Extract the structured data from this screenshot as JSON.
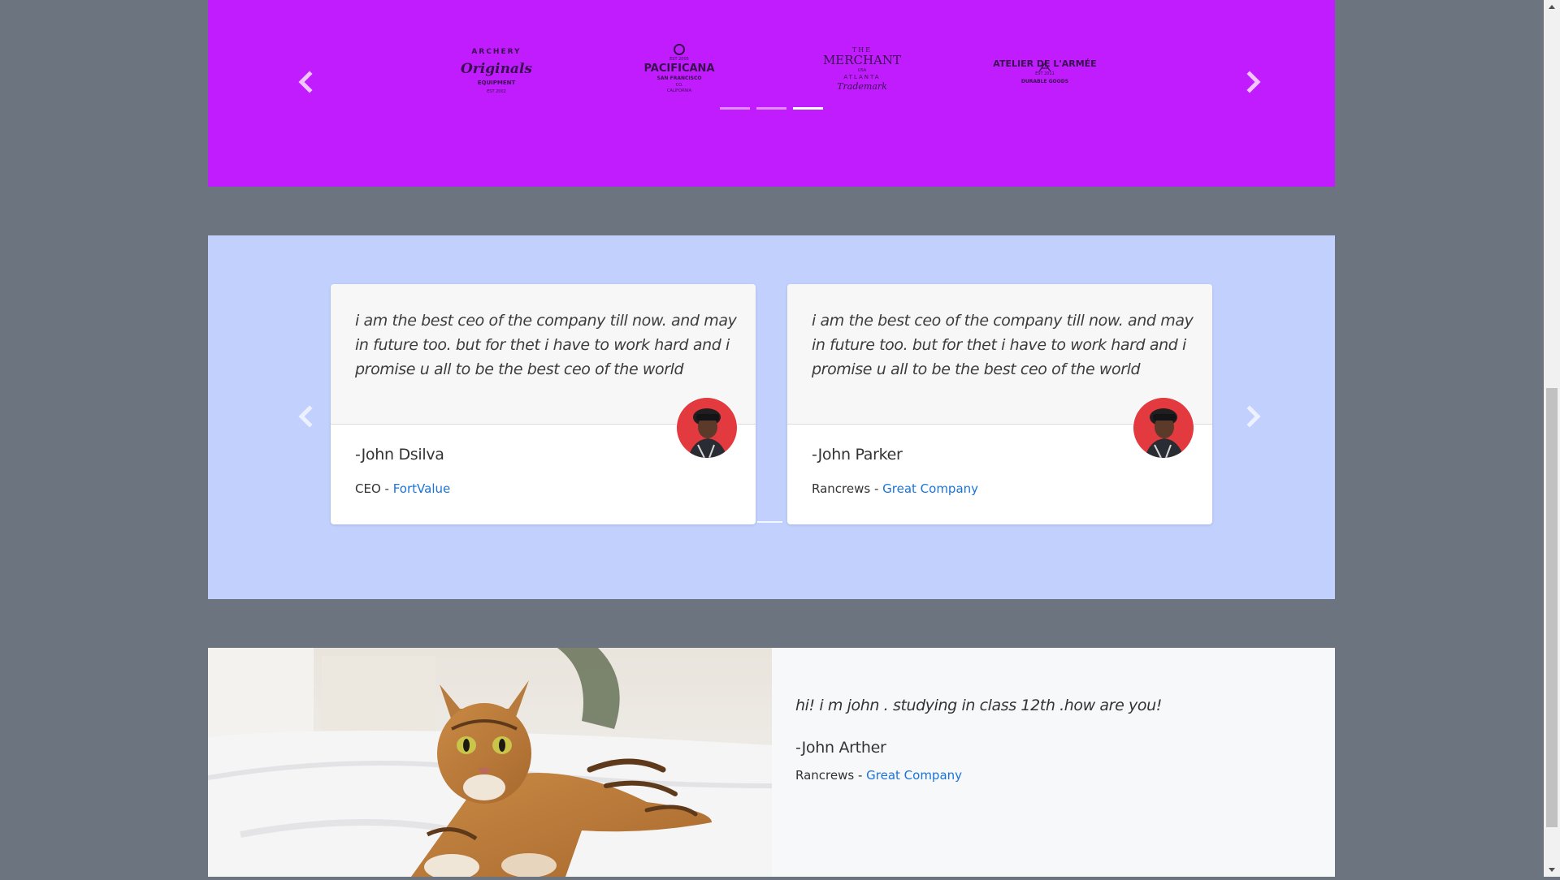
{
  "logo_carousel": {
    "background": "#c11cfe",
    "prev_icon": "chevron-left-icon",
    "next_icon": "chevron-right-icon",
    "logos": [
      {
        "lines": [
          "ARCHERY",
          "Originals",
          "EQUIPMENT",
          "EST 2002"
        ]
      },
      {
        "lines": [
          "EST 2005",
          "PACIFICANA",
          "SAN FRANCISCO",
          "CO.",
          "CALIFORNIA"
        ]
      },
      {
        "lines": [
          "THE",
          "MERCHANT",
          "USA",
          "ATLANTA",
          "Trademark"
        ]
      },
      {
        "lines": [
          "ATELIER DE L'ARMÉE",
          "EST 2011",
          "DURABLE GOODS"
        ]
      }
    ],
    "indicators": 3,
    "active_indicator": 2
  },
  "testimonials": {
    "background": "#c2d0fe",
    "prev_icon": "chevron-left-icon",
    "next_icon": "chevron-right-icon",
    "cards": [
      {
        "quote": "i am the best ceo of the company till now. and may in future too. but for thet i have to work hard and i promise u all to be the best ceo of the world",
        "name": "-John Dsilva",
        "role": "CEO",
        "separator": " - ",
        "company": "FortValue"
      },
      {
        "quote": "i am the best ceo of the company till now. and may in future too. but for thet i have to work hard and i promise u all to be the best ceo of the world",
        "name": "-John Parker",
        "role": "Rancrews",
        "separator": " - ",
        "company": "Great Company"
      }
    ]
  },
  "feature": {
    "quote": "hi! i m john . studying in class 12th .how are you!",
    "name": "-John Arther",
    "role": "Rancrews",
    "separator": " - ",
    "company": "Great Company"
  },
  "colors": {
    "page_bg": "#6c7480",
    "link": "#1a73d9"
  }
}
